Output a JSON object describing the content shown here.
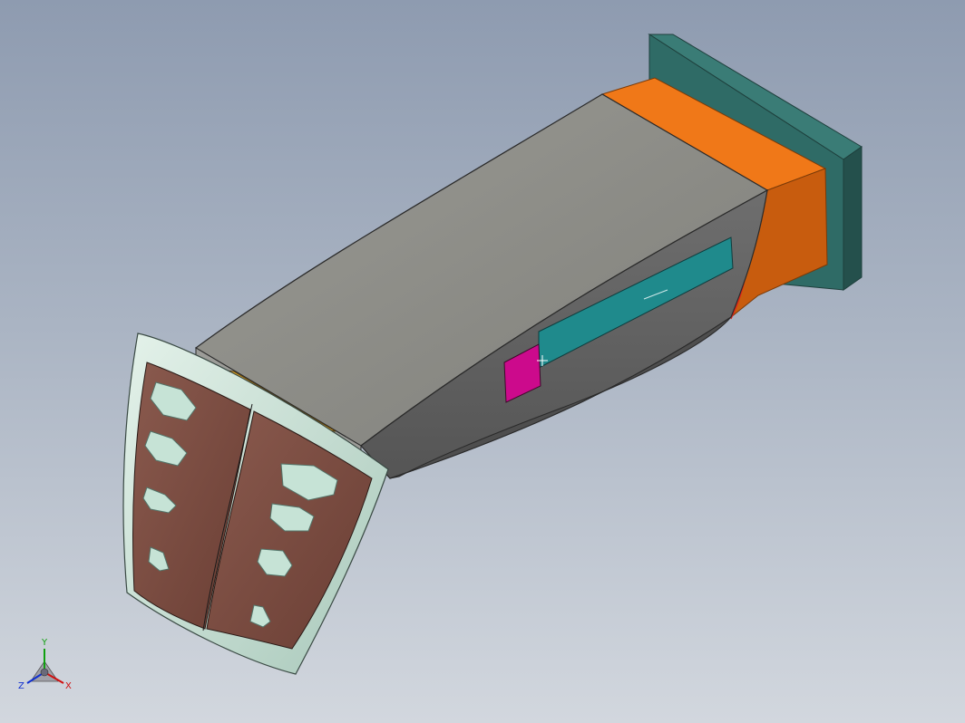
{
  "viewport": {
    "name": "cad-3d-viewport",
    "background_top": "#8e9bb0",
    "background_bottom": "#d2d7de"
  },
  "model": {
    "colors": {
      "body_top": "#8a8a85",
      "body_side": "#6d6d6d",
      "body_bottom": "#5a5a5a",
      "flange": "#2f6b66",
      "flange_side": "#24504c",
      "collar": "#f07818",
      "collar_dark": "#c25a0c",
      "slot": "#1f8a8c",
      "tab": "#cc0a8c",
      "grille_frame": "#c4dcd2",
      "grille_panel": "#7a4a3f",
      "grille_vent": "#c6e3d6",
      "accent_line": "#e0201a"
    }
  },
  "triad": {
    "y_label": "Y",
    "z_label": "Z",
    "x_label": "X",
    "x_color": "#d01010",
    "y_color": "#10a010",
    "z_color": "#1030d0"
  }
}
